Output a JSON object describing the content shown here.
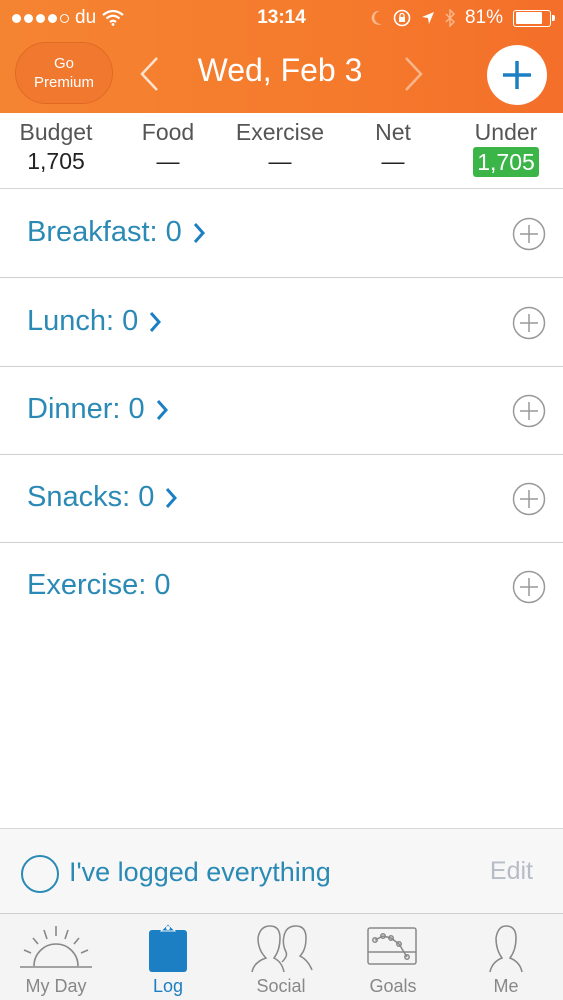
{
  "status_bar": {
    "carrier": "du",
    "time": "13:14",
    "battery": "81%",
    "battery_level": 0.81,
    "signal_bars": 4,
    "signal_total": 5
  },
  "header": {
    "premium_line1": "Go",
    "premium_line2": "Premium",
    "date": "Wed, Feb 3",
    "add_icon": "plus-icon",
    "prev_icon": "chevron-left-icon",
    "next_icon": "chevron-right-icon"
  },
  "summary": {
    "columns": [
      {
        "label": "Budget",
        "value": "1,705"
      },
      {
        "label": "Food",
        "value": "—"
      },
      {
        "label": "Exercise",
        "value": "—"
      },
      {
        "label": "Net",
        "value": "—"
      },
      {
        "label": "Under",
        "value": "1,705"
      }
    ],
    "under_color": "#3bb548"
  },
  "meals": [
    {
      "label": "Breakfast: 0",
      "has_chevron": true
    },
    {
      "label": "Lunch: 0",
      "has_chevron": true
    },
    {
      "label": "Dinner: 0",
      "has_chevron": true
    },
    {
      "label": "Snacks: 0",
      "has_chevron": true
    },
    {
      "label": "Exercise: 0",
      "has_chevron": false
    }
  ],
  "footer": {
    "logged_label": "I've logged everything",
    "edit_label": "Edit"
  },
  "tabs": [
    {
      "label": "My Day",
      "icon": "sunrise-icon",
      "active": false
    },
    {
      "label": "Log",
      "icon": "clipboard-icon",
      "active": true
    },
    {
      "label": "Social",
      "icon": "people-icon",
      "active": false
    },
    {
      "label": "Goals",
      "icon": "chart-icon",
      "active": false
    },
    {
      "label": "Me",
      "icon": "person-icon",
      "active": false
    }
  ],
  "colors": {
    "brand_orange": "#f57a2c",
    "accent_blue": "#2a8ab5",
    "active_tab": "#1c7fc4"
  }
}
